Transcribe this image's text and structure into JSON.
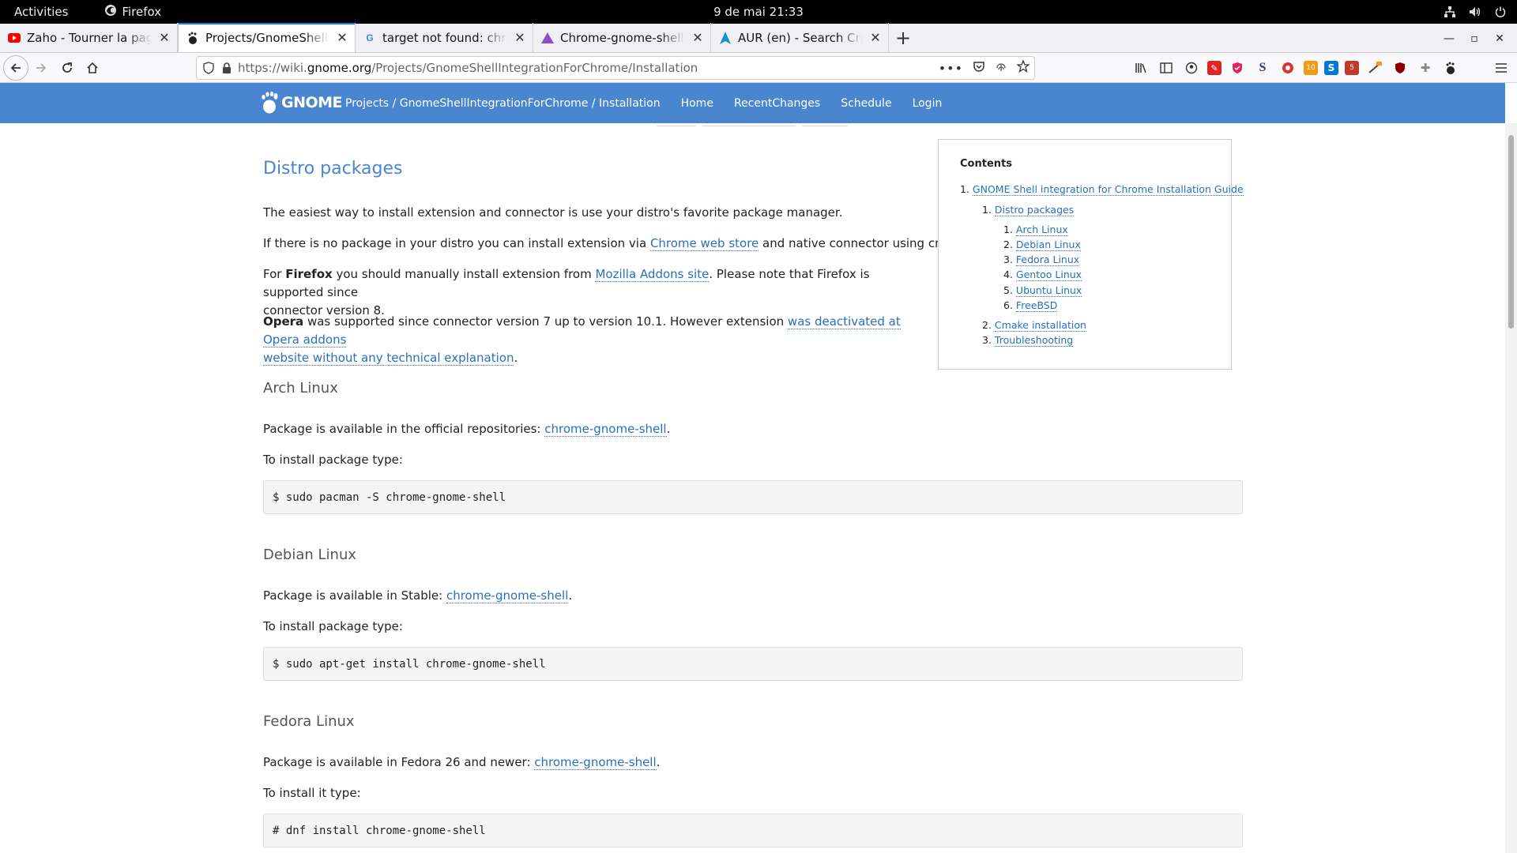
{
  "topbar": {
    "activities": "Activities",
    "app_name": "Firefox",
    "clock": "9 de mai  21:33"
  },
  "tabs": [
    {
      "title": "Zaho - Tourner la page by",
      "favicon": "youtube-icon",
      "active": false
    },
    {
      "title": "Projects/GnomeShellInte",
      "favicon": "gnome-foot-icon",
      "active": true
    },
    {
      "title": "target not found: chrome",
      "favicon": "google-icon",
      "active": false
    },
    {
      "title": "Chrome-gnome-shell - D",
      "favicon": "manjaro-icon",
      "active": false
    },
    {
      "title": "AUR (en) - Search Criteria",
      "favicon": "arch-icon",
      "active": false
    }
  ],
  "urlbar": {
    "url_prefix": "https://wiki.",
    "url_domain": "gnome.org",
    "url_path": "/Projects/GnomeShellIntegrationForChrome/Installation"
  },
  "site": {
    "logo_text": "GNOME",
    "breadcrumb": "Projects / GnomeShellIntegrationForChrome / Installation",
    "nav": [
      "Home",
      "RecentChanges",
      "Schedule",
      "Login"
    ]
  },
  "content": {
    "title": "Distro packages",
    "p1": "The easiest way to install extension and connector is use your distro's favorite package manager.",
    "p2_a": "If there is no package in your distro you can install extension via ",
    "p2_link": "Chrome web store",
    "p2_b": " and native connector using cmake.",
    "p3_a": "For ",
    "p3_bold": "Firefox",
    "p3_b": " you should manually install extension from ",
    "p3_link": "Mozilla Addons site",
    "p3_c": ". Please note that Firefox is supported since",
    "p3_d": "connector version 8.",
    "p4_bold": "Opera",
    "p4_a": " was supported since connector version 7 up to version 10.1. However extension ",
    "p4_link1": "was deactivated at Opera addons",
    "p4_link2": "website without any technical explanation",
    "p4_b": ".",
    "arch": {
      "heading": "Arch Linux",
      "avail": "Package is available in the official repositories: ",
      "link": "chrome-gnome-shell",
      "dot": ".",
      "install": "To install package type:",
      "cmd": "$ sudo pacman -S chrome-gnome-shell"
    },
    "debian": {
      "heading": "Debian Linux",
      "avail": "Package is available in Stable: ",
      "link": "chrome-gnome-shell",
      "dot": ".",
      "install": "To install package type:",
      "cmd": "$ sudo apt-get install chrome-gnome-shell"
    },
    "fedora": {
      "heading": "Fedora Linux",
      "avail": "Package is available in Fedora 26 and newer: ",
      "link": "chrome-gnome-shell",
      "dot": ".",
      "install": "To install it type:",
      "cmd": "# dnf install chrome-gnome-shell"
    }
  },
  "toc": {
    "title": "Contents",
    "items": [
      {
        "num": "1.",
        "label": "GNOME Shell integration for Chrome Installation Guide"
      },
      {
        "num": "1.",
        "label": "Distro packages"
      },
      {
        "num": "1.",
        "label": "Arch Linux"
      },
      {
        "num": "2.",
        "label": "Debian Linux"
      },
      {
        "num": "3.",
        "label": "Fedora Linux"
      },
      {
        "num": "4.",
        "label": "Gentoo Linux"
      },
      {
        "num": "5.",
        "label": "Ubuntu Linux"
      },
      {
        "num": "6.",
        "label": "FreeBSD"
      },
      {
        "num": "2.",
        "label": "Cmake installation"
      },
      {
        "num": "3.",
        "label": "Troubleshooting"
      }
    ]
  },
  "colors": {
    "header_blue": "#4a86cf",
    "link_blue": "#2a6ebd",
    "tab_accent": "#0a84ff"
  }
}
